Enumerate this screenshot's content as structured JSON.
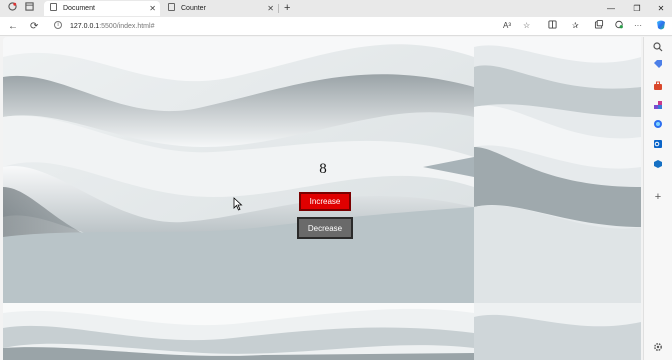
{
  "browser": {
    "tabs": [
      {
        "title": "Document",
        "active": true
      },
      {
        "title": "Counter",
        "active": false
      }
    ],
    "address": {
      "host": "127.0.0.1",
      "path": ":5500/index.html#"
    },
    "reader_label": "A³"
  },
  "page": {
    "counter_value": "8",
    "increase_label": "Increase",
    "decrease_label": "Decrease"
  },
  "colors": {
    "increase_bg": "#e00000",
    "decrease_bg": "#6a6a6a",
    "edge_accent": "#0a84ff"
  },
  "icons": {
    "sidebar": [
      "search-icon",
      "tag-icon",
      "toolbox-icon",
      "games-icon",
      "copilot-icon",
      "outlook-icon",
      "office-icon",
      "add-icon",
      "settings-icon"
    ]
  }
}
